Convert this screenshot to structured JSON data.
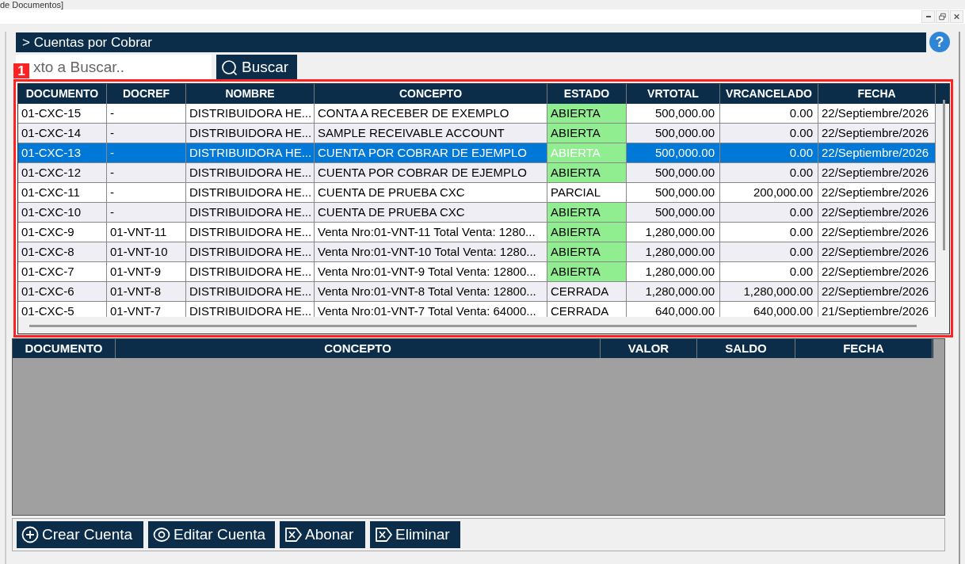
{
  "window": {
    "title": "de Documentos]"
  },
  "panel": {
    "title": "> Cuentas por Cobrar",
    "help": "?"
  },
  "search": {
    "placeholder": "xto a Buscar..",
    "button": "Buscar"
  },
  "annotation": {
    "label": "1"
  },
  "table": {
    "columns": [
      "DOCUMENTO",
      "DOCREF",
      "NOMBRE",
      "CONCEPTO",
      "ESTADO",
      "VRTOTAL",
      "VRCANCELADO",
      "FECHA"
    ],
    "rows": [
      {
        "cells": [
          "01-CXC-15",
          "-",
          "DISTRIBUIDORA HE...",
          "CONTA A RECEBER DE EXEMPLO",
          "ABIERTA",
          "500,000.00",
          "0.00",
          "22/Septiembre/2026"
        ],
        "selected": false,
        "status_highlight": true
      },
      {
        "cells": [
          "01-CXC-14",
          "-",
          "DISTRIBUIDORA HE...",
          "SAMPLE RECEIVABLE ACCOUNT",
          "ABIERTA",
          "500,000.00",
          "0.00",
          "22/Septiembre/2026"
        ],
        "selected": false,
        "status_highlight": true
      },
      {
        "cells": [
          "01-CXC-13",
          "-",
          "DISTRIBUIDORA HE...",
          "CUENTA POR COBRAR DE EJEMPLO",
          "ABIERTA",
          "500,000.00",
          "0.00",
          "22/Septiembre/2026"
        ],
        "selected": true,
        "status_highlight": true
      },
      {
        "cells": [
          "01-CXC-12",
          "-",
          "DISTRIBUIDORA HE...",
          "CUENTA POR COBRAR DE EJEMPLO",
          "ABIERTA",
          "500,000.00",
          "0.00",
          "22/Septiembre/2026"
        ],
        "selected": false,
        "status_highlight": true
      },
      {
        "cells": [
          "01-CXC-11",
          "-",
          "DISTRIBUIDORA HE...",
          "CUENTA DE PRUEBA CXC",
          "PARCIAL",
          "500,000.00",
          "200,000.00",
          "22/Septiembre/2026"
        ],
        "selected": false,
        "status_highlight": false
      },
      {
        "cells": [
          "01-CXC-10",
          "-",
          "DISTRIBUIDORA HE...",
          "CUENTA DE PRUEBA CXC",
          "ABIERTA",
          "500,000.00",
          "0.00",
          "22/Septiembre/2026"
        ],
        "selected": false,
        "status_highlight": true
      },
      {
        "cells": [
          "01-CXC-9",
          "01-VNT-11",
          "DISTRIBUIDORA HE...",
          "Venta Nro:01-VNT-11 Total Venta: 1280...",
          "ABIERTA",
          "1,280,000.00",
          "0.00",
          "22/Septiembre/2026"
        ],
        "selected": false,
        "status_highlight": true
      },
      {
        "cells": [
          "01-CXC-8",
          "01-VNT-10",
          "DISTRIBUIDORA HE...",
          "Venta Nro:01-VNT-10 Total Venta: 1280...",
          "ABIERTA",
          "1,280,000.00",
          "0.00",
          "22/Septiembre/2026"
        ],
        "selected": false,
        "status_highlight": true
      },
      {
        "cells": [
          "01-CXC-7",
          "01-VNT-9",
          "DISTRIBUIDORA HE...",
          "Venta Nro:01-VNT-9 Total Venta: 12800...",
          "ABIERTA",
          "1,280,000.00",
          "0.00",
          "22/Septiembre/2026"
        ],
        "selected": false,
        "status_highlight": true
      },
      {
        "cells": [
          "01-CXC-6",
          "01-VNT-8",
          "DISTRIBUIDORA HE...",
          "Venta Nro:01-VNT-8 Total Venta: 12800...",
          "CERRADA",
          "1,280,000.00",
          "1,280,000.00",
          "22/Septiembre/2026"
        ],
        "selected": false,
        "status_highlight": false
      },
      {
        "cells": [
          "01-CXC-5",
          "01-VNT-7",
          "DISTRIBUIDORA HE...",
          "Venta Nro:01-VNT-7 Total Venta: 64000...",
          "CERRADA",
          "640,000.00",
          "640,000.00",
          "21/Septiembre/2026"
        ],
        "selected": false,
        "status_highlight": false
      }
    ]
  },
  "detail_table": {
    "columns": [
      "DOCUMENTO",
      "CONCEPTO",
      "VALOR",
      "SALDO",
      "FECHA"
    ]
  },
  "buttons": [
    {
      "label": "Crear Cuenta",
      "kind": "plus"
    },
    {
      "label": "Editar Cuenta",
      "kind": "eye"
    },
    {
      "label": "Abonar",
      "kind": "tagx"
    },
    {
      "label": "Eliminar",
      "kind": "tagx"
    }
  ]
}
